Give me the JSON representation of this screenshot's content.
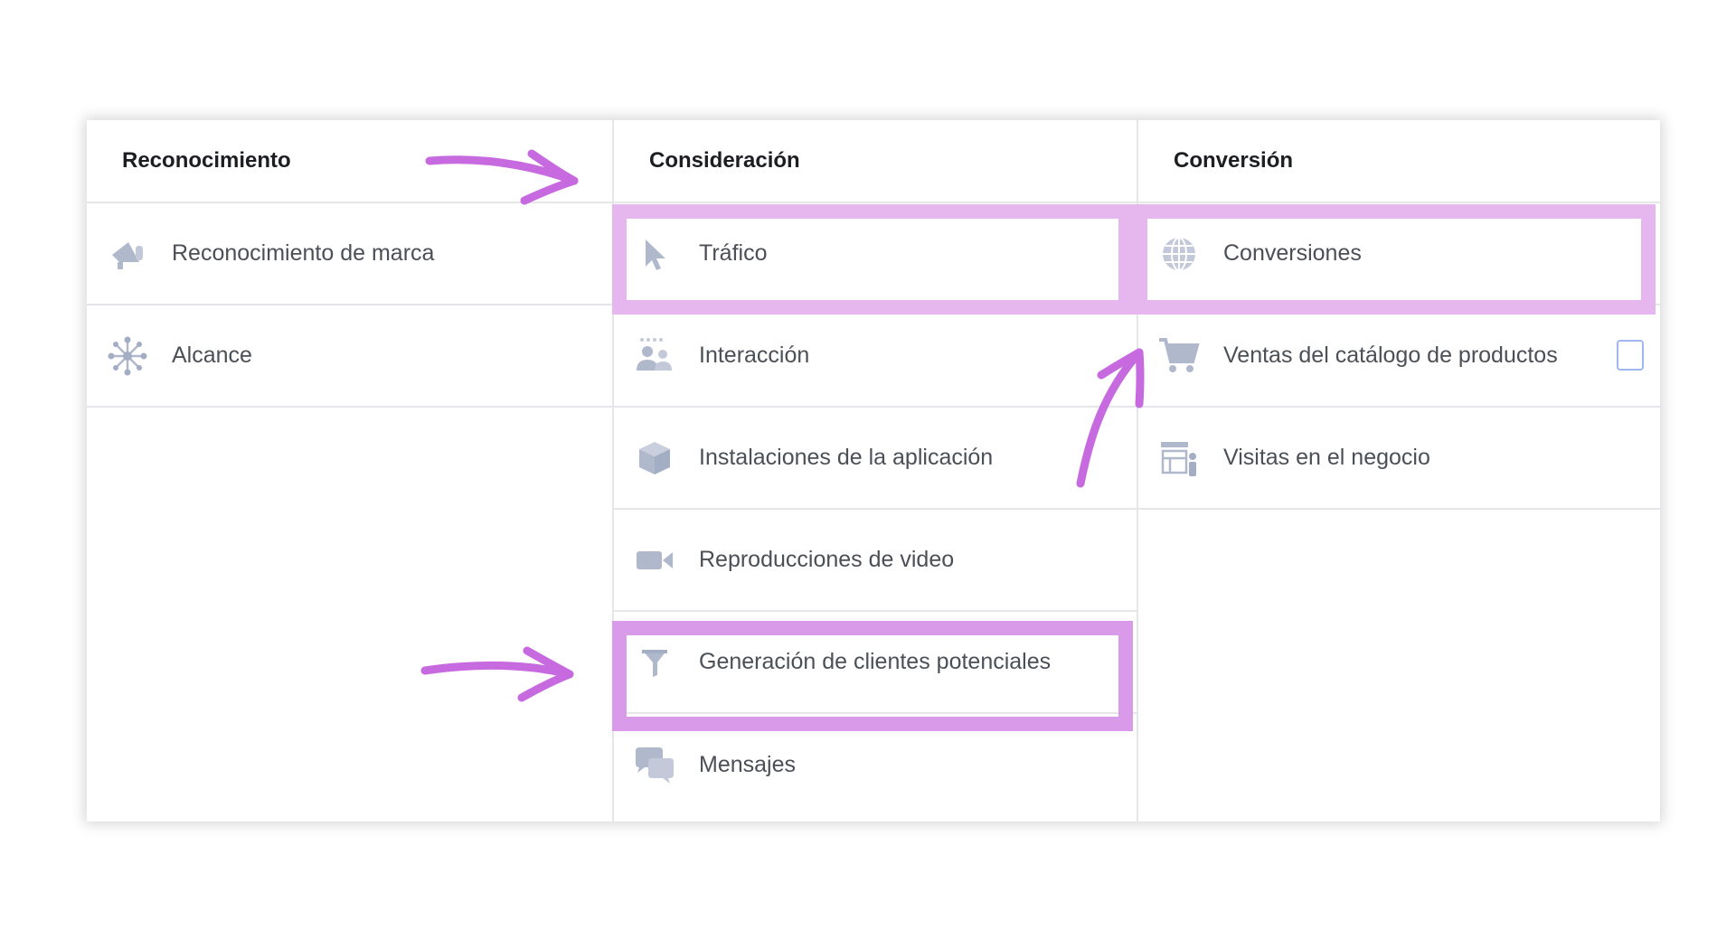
{
  "columns": [
    {
      "heading": "Reconocimiento",
      "items": [
        {
          "label": "Reconocimiento de marca",
          "icon": "megaphone-icon"
        },
        {
          "label": "Alcance",
          "icon": "reach-network-icon"
        }
      ]
    },
    {
      "heading": "Consideración",
      "items": [
        {
          "label": "Tráfico",
          "icon": "cursor-icon"
        },
        {
          "label": "Interacción",
          "icon": "people-icon"
        },
        {
          "label": "Instalaciones de la aplicación",
          "icon": "cube-icon"
        },
        {
          "label": "Reproducciones de video",
          "icon": "video-camera-icon"
        },
        {
          "label": "Generación de clientes potenciales",
          "icon": "funnel-icon"
        },
        {
          "label": "Mensajes",
          "icon": "chat-bubbles-icon"
        }
      ]
    },
    {
      "heading": "Conversión",
      "items": [
        {
          "label": "Conversiones",
          "icon": "globe-icon"
        },
        {
          "label": "Ventas del catálogo de productos",
          "icon": "shopping-cart-icon",
          "checkbox_checked": false
        },
        {
          "label": "Visitas en el negocio",
          "icon": "store-visit-icon"
        }
      ]
    }
  ],
  "highlighted_items": [
    "Tráfico",
    "Conversiones",
    "Generación de clientes potenciales"
  ],
  "colors": {
    "highlight": "#d99be9",
    "highlight_light": "#e6b7ef",
    "arrow": "#c76ae0",
    "icon": "#b0b8cc",
    "checkbox": "#9fb7f0"
  }
}
